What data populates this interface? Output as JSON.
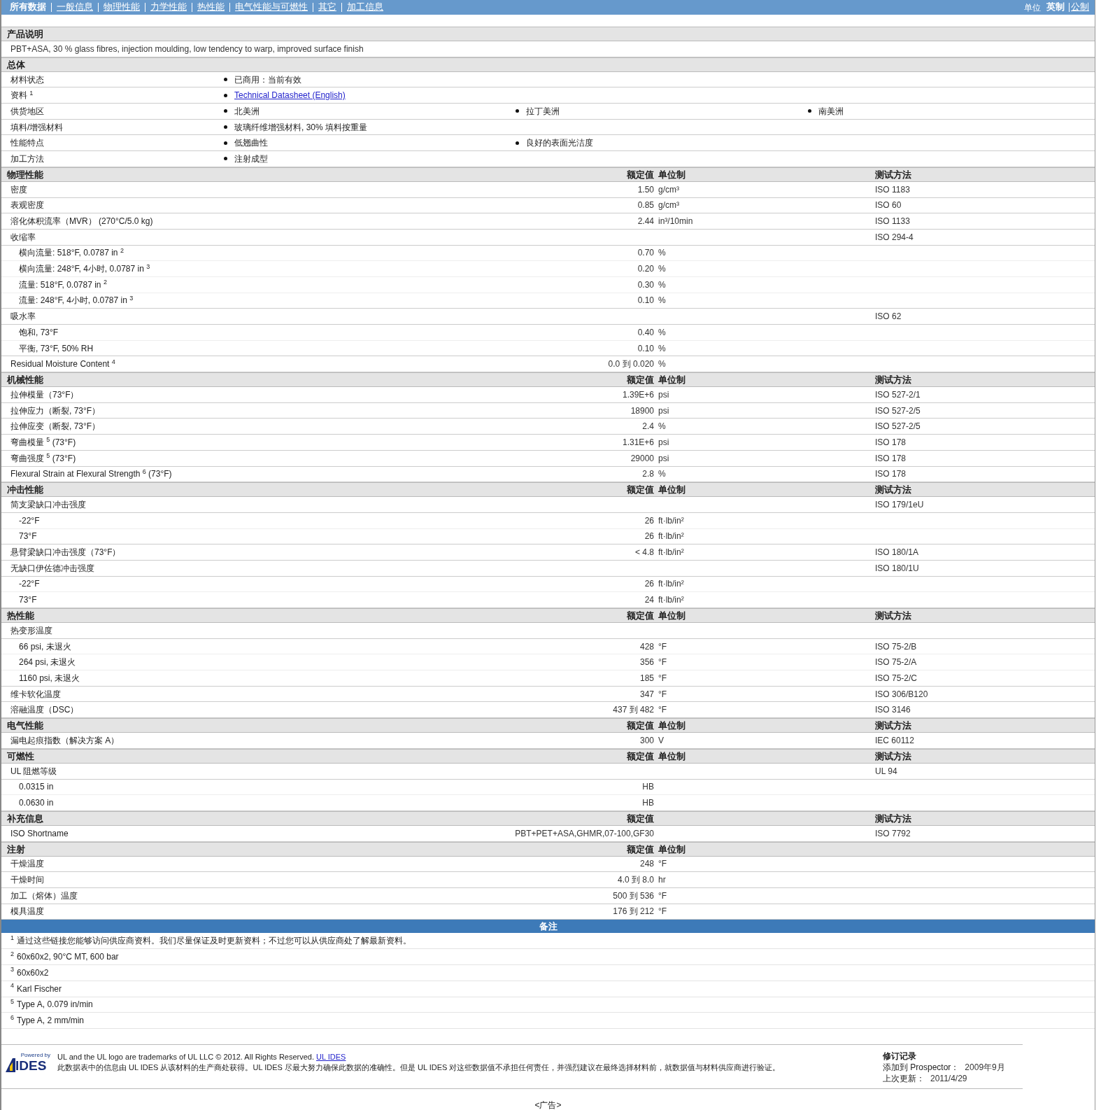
{
  "nav": {
    "tabs": [
      {
        "label": "所有数据",
        "selected": true
      },
      {
        "label": "一般信息",
        "selected": false
      },
      {
        "label": "物理性能",
        "selected": false
      },
      {
        "label": "力学性能",
        "selected": false
      },
      {
        "label": "热性能",
        "selected": false
      },
      {
        "label": "电气性能与可燃性",
        "selected": false
      },
      {
        "label": "其它",
        "selected": false
      },
      {
        "label": "加工信息",
        "selected": false
      }
    ],
    "units": {
      "label": "单位",
      "options": [
        {
          "label": "英制",
          "selected": true
        },
        {
          "label": "公制",
          "selected": false
        }
      ]
    }
  },
  "sections": [
    {
      "title": "产品说明",
      "rows": [
        {
          "kind": "text",
          "text": "PBT+ASA, 30 % glass fibres, injection moulding, low tendency to warp, improved surface finish"
        }
      ]
    },
    {
      "title": "总体",
      "rows": [
        {
          "kind": "bullets",
          "label": "材料状态",
          "items": [
            {
              "kind": "text",
              "text": "已商用：当前有效"
            }
          ]
        },
        {
          "kind": "bullets",
          "label": "资料 $^{1}$",
          "items": [
            {
              "kind": "link",
              "text": "Technical Datasheet (English)"
            }
          ]
        },
        {
          "kind": "bullets",
          "label": "供货地区",
          "items": [
            {
              "kind": "text",
              "text": "北美洲"
            },
            {
              "kind": "text",
              "text": "拉丁美洲"
            },
            {
              "kind": "text",
              "text": "南美洲"
            }
          ]
        },
        {
          "kind": "bullets",
          "label": "填料/增强材料",
          "items": [
            {
              "kind": "text",
              "text": "玻璃纤维增强材料, 30% 填料按重量"
            }
          ]
        },
        {
          "kind": "bullets",
          "label": "性能特点",
          "items": [
            {
              "kind": "text",
              "text": "低翘曲性"
            },
            {
              "kind": "text",
              "text": "良好的表面光洁度"
            }
          ]
        },
        {
          "kind": "bullets",
          "label": "加工方法",
          "items": [
            {
              "kind": "text",
              "text": "注射成型"
            }
          ]
        }
      ]
    },
    {
      "title": "物理性能",
      "headers": {
        "value": "额定值",
        "unit": "单位制",
        "method": "测试方法"
      },
      "rows": [
        {
          "kind": "data",
          "label": "密度",
          "value": "1.50",
          "unit": "g/cm³",
          "method": "ISO 1183"
        },
        {
          "kind": "data",
          "label": "表观密度",
          "value": "0.85",
          "unit": "g/cm³",
          "method": "ISO 60"
        },
        {
          "kind": "data",
          "label": "溶化体积流率（MVR） (270°C/5.0 kg)",
          "value": "2.44",
          "unit": "in³/10min",
          "method": "ISO 1133"
        },
        {
          "kind": "data",
          "label": "收缩率",
          "method": "ISO 294-4",
          "children": [
            {
              "label": "横向流量: 518°F, 0.0787 in $^{2}$",
              "value": "0.70",
              "unit": "%"
            },
            {
              "label": "横向流量: 248°F, 4小时, 0.0787 in $^{3}$",
              "value": "0.20",
              "unit": "%"
            },
            {
              "label": "流量: 518°F, 0.0787 in $^{2}$",
              "value": "0.30",
              "unit": "%"
            },
            {
              "label": "流量: 248°F, 4小时, 0.0787 in $^{3}$",
              "value": "0.10",
              "unit": "%"
            }
          ]
        },
        {
          "kind": "data",
          "label": "吸水率",
          "method": "ISO 62",
          "children": [
            {
              "label": "饱和, 73°F",
              "value": "0.40",
              "unit": "%"
            },
            {
              "label": "平衡, 73°F, 50% RH",
              "value": "0.10",
              "unit": "%"
            }
          ]
        },
        {
          "kind": "data",
          "label": "Residual Moisture Content $^{4}$",
          "value": "0.0 到 0.020",
          "unit": "%"
        }
      ]
    },
    {
      "title": "机械性能",
      "headers": {
        "value": "额定值",
        "unit": "单位制",
        "method": "测试方法"
      },
      "rows": [
        {
          "kind": "data",
          "label": "拉伸模量（73°F）",
          "value": "1.39E+6",
          "unit": "psi",
          "method": "ISO 527-2/1"
        },
        {
          "kind": "data",
          "label": "拉伸应力（断裂, 73°F）",
          "value": "18900",
          "unit": "psi",
          "method": "ISO 527-2/5"
        },
        {
          "kind": "data",
          "label": "拉伸应变（断裂, 73°F）",
          "value": "2.4",
          "unit": "%",
          "method": "ISO 527-2/5"
        },
        {
          "kind": "data",
          "label": "弯曲模量 $^{5}$ (73°F)",
          "value": "1.31E+6",
          "unit": "psi",
          "method": "ISO 178"
        },
        {
          "kind": "data",
          "label": "弯曲强度 $^{5}$ (73°F)",
          "value": "29000",
          "unit": "psi",
          "method": "ISO 178"
        },
        {
          "kind": "data",
          "label": "Flexural Strain at Flexural Strength $^{6}$ (73°F)",
          "value": "2.8",
          "unit": "%",
          "method": "ISO 178"
        }
      ]
    },
    {
      "title": "冲击性能",
      "headers": {
        "value": "额定值",
        "unit": "单位制",
        "method": "测试方法"
      },
      "rows": [
        {
          "kind": "data",
          "label": "简支梁缺口冲击强度",
          "method": "ISO 179/1eU",
          "children": [
            {
              "label": "-22°F",
              "value": "26",
              "unit": "ft·lb/in²"
            },
            {
              "label": "73°F",
              "value": "26",
              "unit": "ft·lb/in²"
            }
          ]
        },
        {
          "kind": "data",
          "label": "悬臂梁缺口冲击强度（73°F）",
          "value": "< 4.8",
          "unit": "ft·lb/in²",
          "method": "ISO 180/1A"
        },
        {
          "kind": "data",
          "label": "无缺口伊佐德冲击强度",
          "method": "ISO 180/1U",
          "children": [
            {
              "label": "-22°F",
              "value": "26",
              "unit": "ft·lb/in²"
            },
            {
              "label": "73°F",
              "value": "24",
              "unit": "ft·lb/in²"
            }
          ]
        }
      ]
    },
    {
      "title": "热性能",
      "headers": {
        "value": "额定值",
        "unit": "单位制",
        "method": "测试方法"
      },
      "rows": [
        {
          "kind": "data",
          "label": "热变形温度",
          "children": [
            {
              "label": "66 psi, 未退火",
              "value": "428",
              "unit": "°F",
              "method": "ISO 75-2/B"
            },
            {
              "label": "264 psi, 未退火",
              "value": "356",
              "unit": "°F",
              "method": "ISO 75-2/A"
            },
            {
              "label": "1160 psi, 未退火",
              "value": "185",
              "unit": "°F",
              "method": "ISO 75-2/C"
            }
          ]
        },
        {
          "kind": "data",
          "label": "维卡软化温度",
          "value": "347",
          "unit": "°F",
          "method": "ISO 306/B120"
        },
        {
          "kind": "data",
          "label": "溶融温度（DSC）",
          "value": "437 到 482",
          "unit": "°F",
          "method": "ISO 3146"
        }
      ]
    },
    {
      "title": "电气性能",
      "headers": {
        "value": "额定值",
        "unit": "单位制",
        "method": "测试方法"
      },
      "rows": [
        {
          "kind": "data",
          "label": "漏电起痕指数（解决方案 A）",
          "value": "300",
          "unit": "V",
          "method": "IEC 60112"
        }
      ]
    },
    {
      "title": "可燃性",
      "headers": {
        "value": "额定值",
        "unit": "单位制",
        "method": "测试方法"
      },
      "rows": [
        {
          "kind": "data",
          "label": "UL 阻燃等级",
          "method": "UL 94",
          "children": [
            {
              "label": "0.0315 in",
              "value": "HB"
            },
            {
              "label": "0.0630 in",
              "value": "HB"
            }
          ]
        }
      ]
    },
    {
      "title": "补充信息",
      "headers": {
        "value": "额定值",
        "method": "测试方法"
      },
      "rows": [
        {
          "kind": "data",
          "label": "ISO Shortname",
          "value": "PBT+PET+ASA,GHMR,07-100,GF30",
          "method": "ISO 7792"
        }
      ]
    },
    {
      "title": "注射",
      "headers": {
        "value": "额定值",
        "unit": "单位制"
      },
      "rows": [
        {
          "kind": "data",
          "label": "干燥温度",
          "value": "248",
          "unit": "°F"
        },
        {
          "kind": "data",
          "label": "干燥时间",
          "value": "4.0 到 8.0",
          "unit": "hr"
        },
        {
          "kind": "data",
          "label": "加工（熔体）温度",
          "value": "500 到 536",
          "unit": "°F"
        },
        {
          "kind": "data",
          "label": "模具温度",
          "value": "176 到 212",
          "unit": "°F"
        }
      ]
    }
  ],
  "notes": {
    "title": "备注",
    "items": [
      {
        "num": "1",
        "text": "通过这些链接您能够访问供应商资料。我们尽量保证及时更新资料；不过您可以从供应商处了解最新资料。"
      },
      {
        "num": "2",
        "text": "60x60x2, 90°C MT, 600 bar"
      },
      {
        "num": "3",
        "text": "60x60x2"
      },
      {
        "num": "4",
        "text": "Karl Fischer"
      },
      {
        "num": "5",
        "text": "Type A, 0.079 in/min"
      },
      {
        "num": "6",
        "text": "Type A, 2 mm/min"
      }
    ]
  },
  "footer": {
    "logo": {
      "tagline": "Powered by",
      "name": "IDES"
    },
    "trademark": "UL and the UL logo are trademarks of UL LLC © 2012. All Rights Reserved.",
    "trademark_link": "UL IDES",
    "disclaimer": "此数据表中的信息由 UL IDES 从该材料的生产商处获得。UL IDES 尽最大努力确保此数据的准确性。但是 UL IDES 对这些数据值不承担任何责任，并强烈建议在最终选择材料前，就数据值与材料供应商进行验证。",
    "revision": {
      "title": "修订记录",
      "lines": [
        {
          "label": "添加到 Prospector：",
          "value": "2009年9月"
        },
        {
          "label": "上次更新：",
          "value": "2011/4/29"
        }
      ]
    }
  },
  "ad": "<广告>"
}
